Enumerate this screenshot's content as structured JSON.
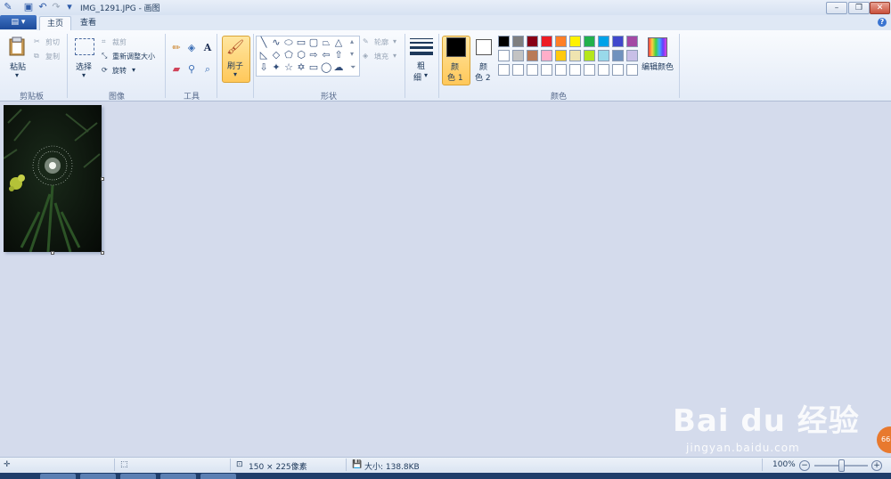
{
  "window": {
    "title": "IMG_1291.JPG - 画图"
  },
  "tabs": {
    "home": "主页",
    "view": "查看"
  },
  "clipboard": {
    "paste": "粘贴",
    "cut": "剪切",
    "copy": "复制",
    "group": "剪贴板"
  },
  "image": {
    "select": "选择",
    "crop": "裁剪",
    "resize": "重新调整大小",
    "rotate": "旋转",
    "group": "图像"
  },
  "tools": {
    "group": "工具"
  },
  "brush": {
    "label": "刷子"
  },
  "shapes": {
    "outline": "轮廓",
    "fill": "填充",
    "group": "形状"
  },
  "size": {
    "label_line1": "粗",
    "label_line2": "细"
  },
  "colors": {
    "color1_line1": "颜",
    "color1_line2": "色 1",
    "color2_line1": "颜",
    "color2_line2": "色 2",
    "edit": "编辑颜色",
    "group": "颜色",
    "color1_value": "#000000",
    "color2_value": "#ffffff",
    "palette_row1": [
      "#000000",
      "#7f7f7f",
      "#880015",
      "#ed1c24",
      "#ff7f27",
      "#fff200",
      "#22b14c",
      "#00a2e8",
      "#3f48cc",
      "#a349a4"
    ],
    "palette_row2": [
      "#ffffff",
      "#c3c3c3",
      "#b97a57",
      "#ffaec9",
      "#ffc90e",
      "#efe4b0",
      "#b5e61d",
      "#99d9ea",
      "#7092be",
      "#c8bfe7"
    ],
    "palette_row3": [
      "#ffffff",
      "#ffffff",
      "#ffffff",
      "#ffffff",
      "#ffffff",
      "#ffffff",
      "#ffffff",
      "#ffffff",
      "#ffffff",
      "#ffffff"
    ]
  },
  "status": {
    "dimensions": "150 × 225像素",
    "filesize": "大小: 138.8KB",
    "zoom": "100%"
  },
  "watermark": {
    "logo": "Bai du 经验",
    "url": "jingyan.baidu.com",
    "badge": "66"
  }
}
